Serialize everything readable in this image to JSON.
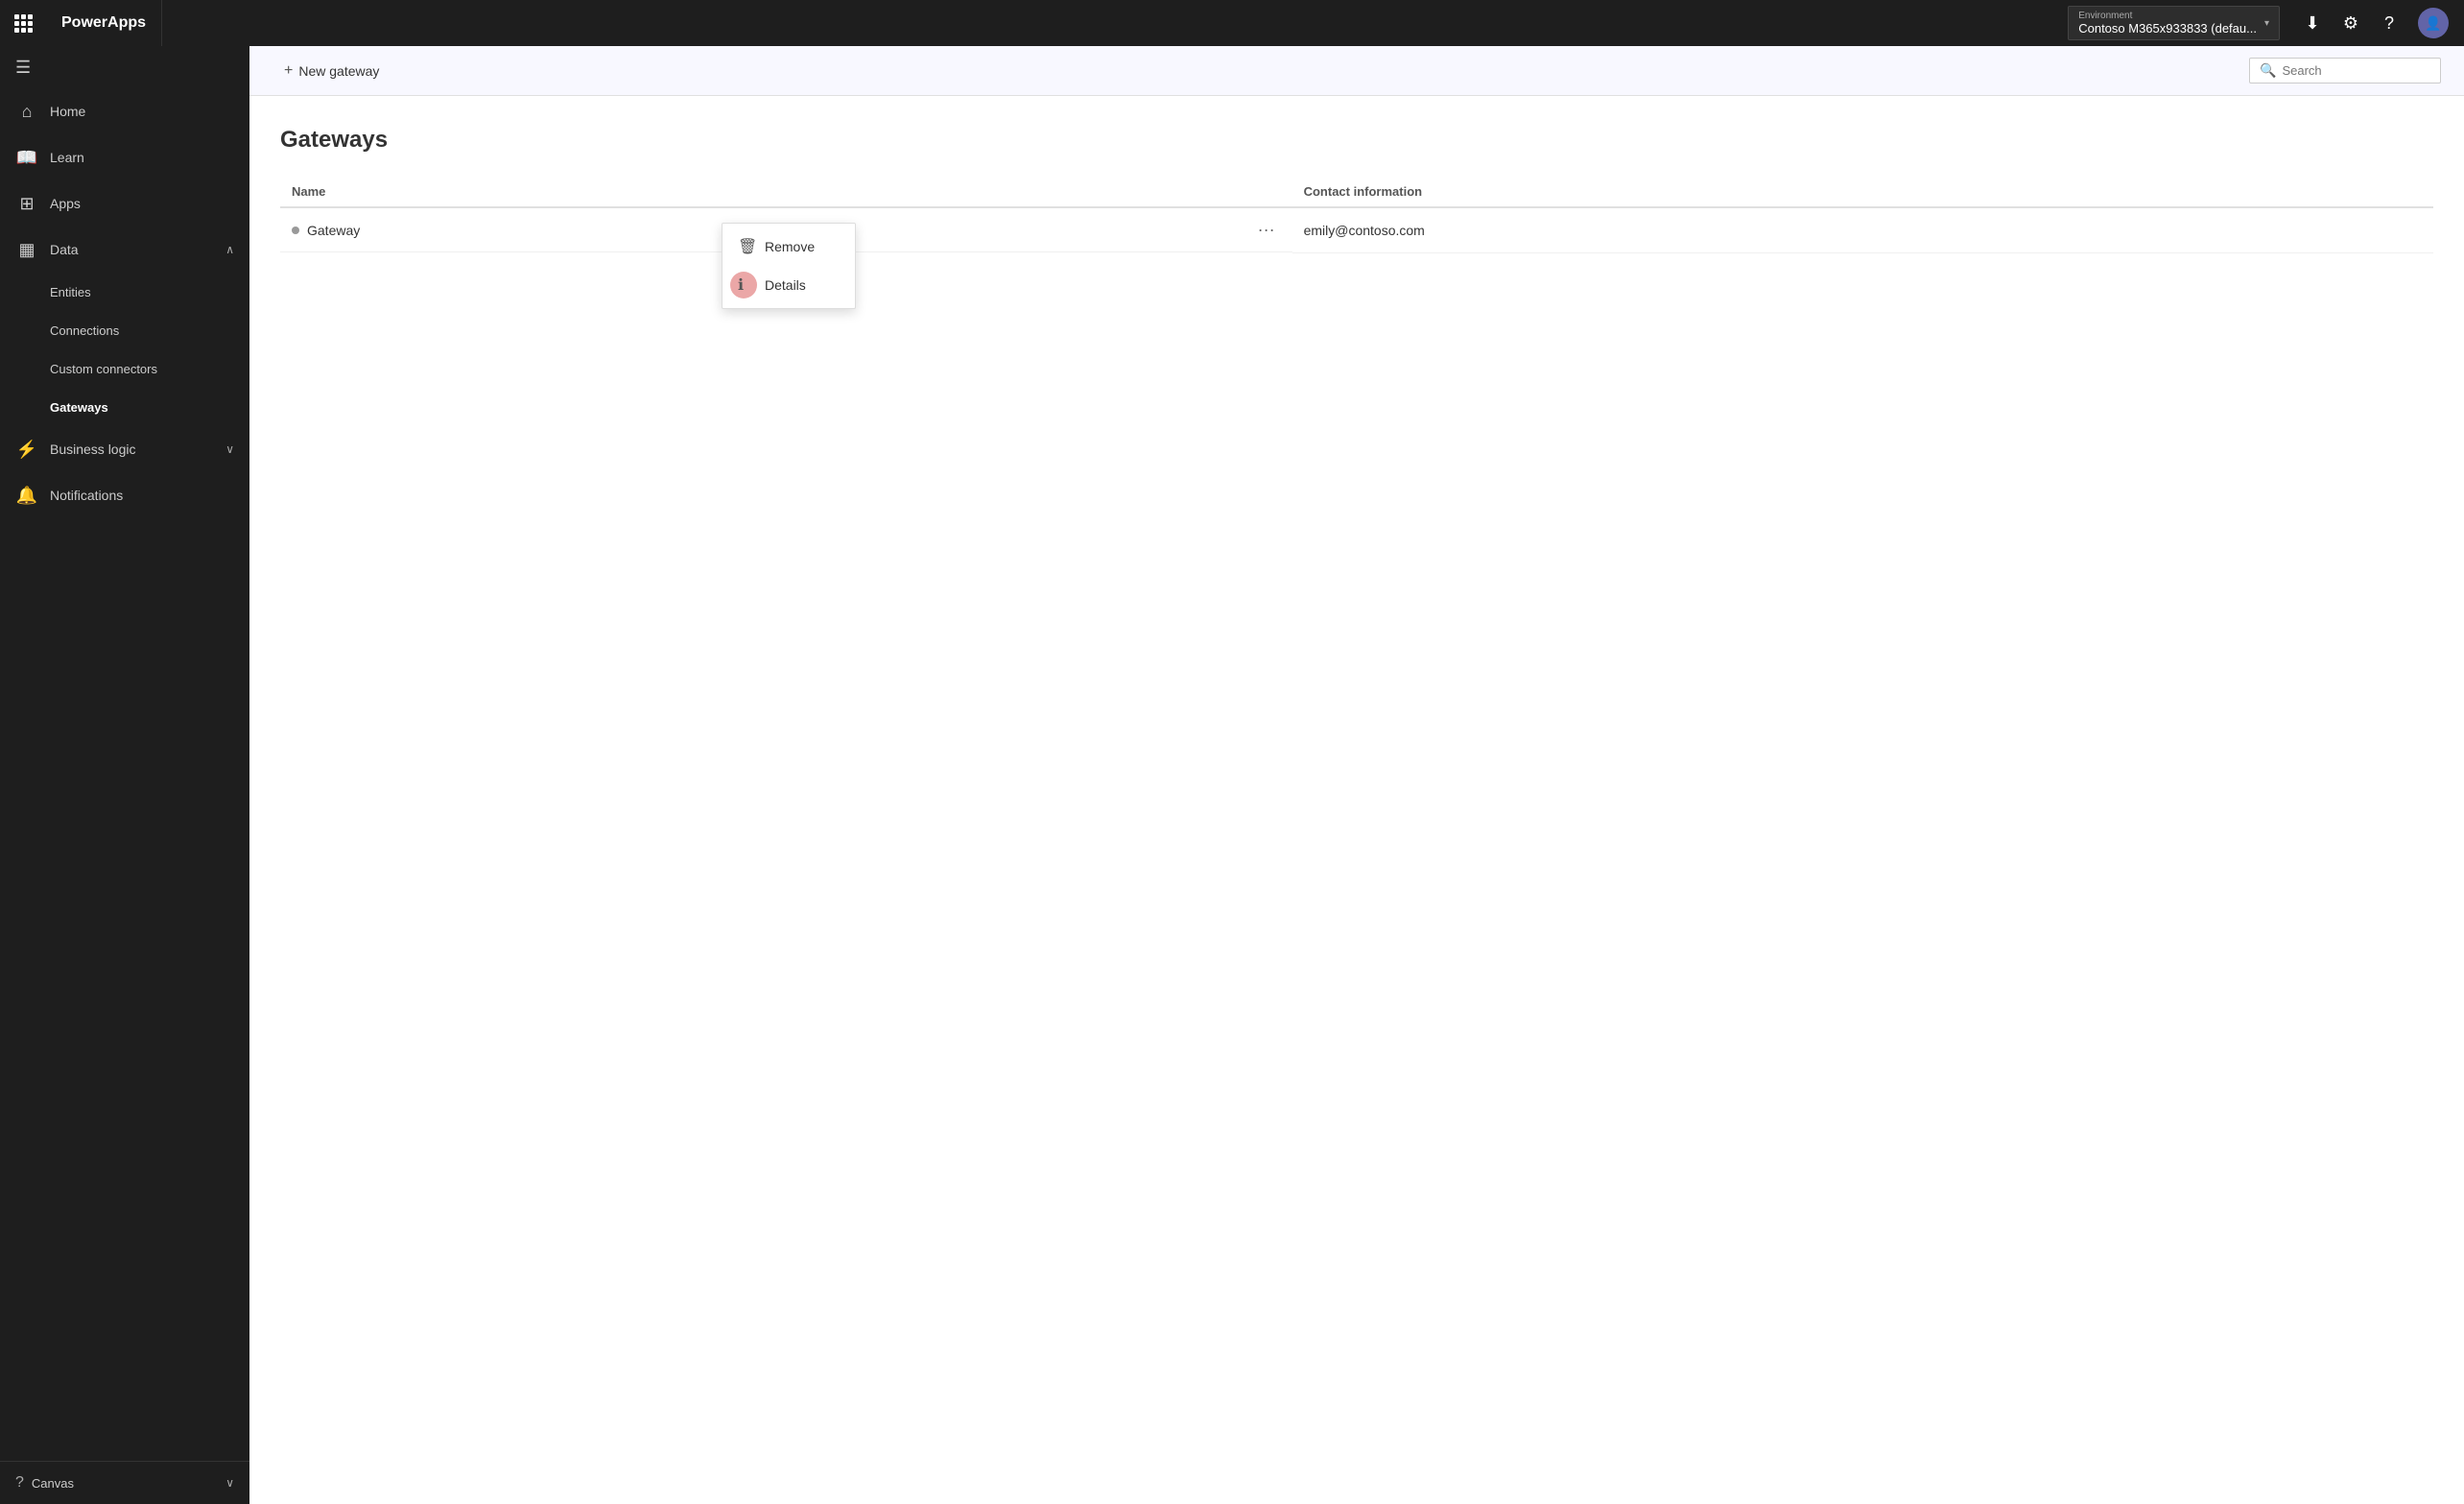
{
  "topbar": {
    "app_name": "PowerApps",
    "env_label": "Environment",
    "env_name": "Contoso M365x933833 (defau...",
    "search_placeholder": "Search"
  },
  "sidebar": {
    "toggle_label": "≡",
    "items": [
      {
        "id": "home",
        "label": "Home",
        "icon": "⌂",
        "active": false
      },
      {
        "id": "learn",
        "label": "Learn",
        "icon": "📖",
        "active": false
      },
      {
        "id": "apps",
        "label": "Apps",
        "icon": "⊞",
        "active": false
      },
      {
        "id": "data",
        "label": "Data",
        "icon": "⊟",
        "active": false,
        "expandable": true,
        "expanded": true
      },
      {
        "id": "business-logic",
        "label": "Business logic",
        "icon": "⚡",
        "active": false,
        "expandable": true
      },
      {
        "id": "notifications",
        "label": "Notifications",
        "icon": "🔔",
        "active": false
      }
    ],
    "data_sub_items": [
      {
        "id": "entities",
        "label": "Entities"
      },
      {
        "id": "connections",
        "label": "Connections"
      },
      {
        "id": "custom-connectors",
        "label": "Custom connectors"
      },
      {
        "id": "gateways",
        "label": "Gateways",
        "active": true
      }
    ],
    "bottom": {
      "canvas_label": "Canvas",
      "help_icon": "?"
    }
  },
  "toolbar": {
    "new_gateway_label": "+ New gateway"
  },
  "page": {
    "title": "Gateways",
    "table": {
      "col_name": "Name",
      "col_contact": "Contact information",
      "rows": [
        {
          "name": "Gateway",
          "contact": "emily@contoso.com"
        }
      ]
    }
  },
  "context_menu": {
    "items": [
      {
        "id": "remove",
        "label": "Remove",
        "icon": "🗑"
      },
      {
        "id": "details",
        "label": "Details",
        "icon": "ℹ"
      }
    ]
  }
}
